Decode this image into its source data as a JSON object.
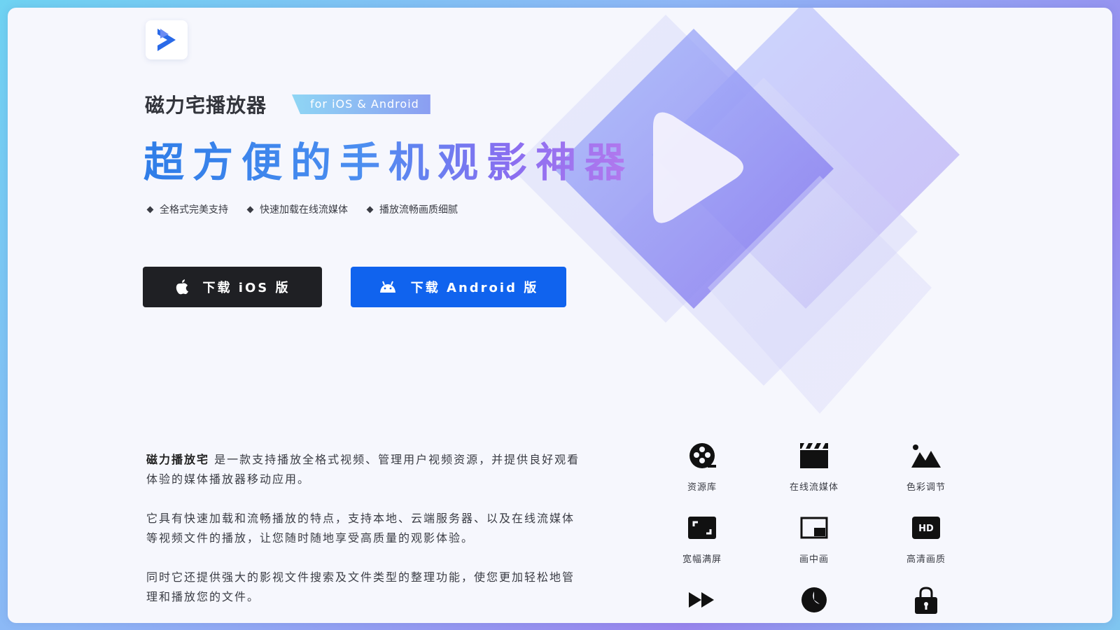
{
  "app": {
    "name": "磁力宅播放器",
    "platform_tag": "for iOS & Android"
  },
  "headline": "超方便的手机观影神器",
  "features": [
    "全格式完美支持",
    "快速加载在线流媒体",
    "播放流畅画质细腻"
  ],
  "buttons": {
    "ios_label": "下载 iOS 版",
    "android_label": "下载 Android 版"
  },
  "description": {
    "brand": "磁力播放宅",
    "p1_rest": " 是一款支持播放全格式视频、管理用户视频资源，并提供良好观看体验的媒体播放器移动应用。",
    "p2": "它具有快速加载和流畅播放的特点，支持本地、云端服务器、以及在线流媒体等视频文件的播放，让您随时随地享受高质量的观影体验。",
    "p3": "同时它还提供强大的影视文件搜索及文件类型的整理功能，使您更加轻松地管理和播放您的文件。"
  },
  "feature_grid": [
    {
      "label": "资源库",
      "icon": "film-reel-icon"
    },
    {
      "label": "在线流媒体",
      "icon": "clapperboard-icon"
    },
    {
      "label": "色彩调节",
      "icon": "mountain-icon"
    },
    {
      "label": "宽幅满屏",
      "icon": "fullscreen-icon"
    },
    {
      "label": "画中画",
      "icon": "picture-in-picture-icon"
    },
    {
      "label": "高清画质",
      "icon": "hd-icon"
    },
    {
      "label": "",
      "icon": "fast-forward-icon"
    },
    {
      "label": "",
      "icon": "timer-icon"
    },
    {
      "label": "",
      "icon": "lock-icon"
    }
  ],
  "colors": {
    "accent": "#1063ee",
    "dark_button": "#1f2024",
    "text": "#3a3c44"
  }
}
